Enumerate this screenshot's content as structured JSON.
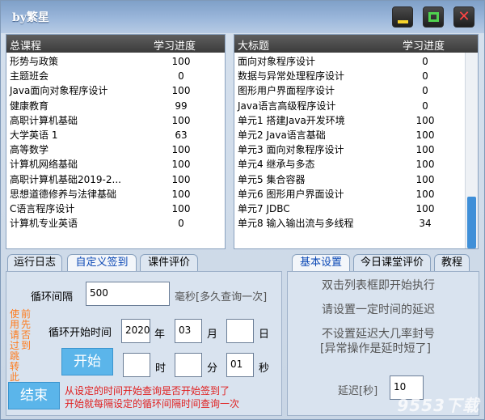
{
  "window": {
    "title": "by繁星"
  },
  "left_list": {
    "headers": [
      "总课程",
      "学习进度"
    ],
    "rows": [
      [
        "形势与政策",
        "100"
      ],
      [
        "主题班会",
        "0"
      ],
      [
        "Java面向对象程序设计",
        "100"
      ],
      [
        "健康教育",
        "99"
      ],
      [
        "高职计算机基础",
        "100"
      ],
      [
        "大学英语 1",
        "63"
      ],
      [
        "高等数学",
        "100"
      ],
      [
        "计算机网络基础",
        "100"
      ],
      [
        "高职计算机基础2019-2...",
        "100"
      ],
      [
        "思想道德修养与法律基础",
        "100"
      ],
      [
        "C语言程序设计",
        "100"
      ],
      [
        "计算机专业英语",
        "0"
      ]
    ]
  },
  "right_list": {
    "headers": [
      "大标题",
      "学习进度"
    ],
    "rows": [
      [
        "面向对象程序设计",
        "0"
      ],
      [
        "数据与异常处理程序设计",
        "0"
      ],
      [
        "图形用户界面程序设计",
        "0"
      ],
      [
        "Java语言高级程序设计",
        "0"
      ],
      [
        "单元1  搭建Java开发环境",
        "100"
      ],
      [
        "单元2  Java语言基础",
        "100"
      ],
      [
        "单元3  面向对象程序设计",
        "100"
      ],
      [
        "单元4  继承与多态",
        "100"
      ],
      [
        "单元5  集合容器",
        "100"
      ],
      [
        "单元6  图形用户界面设计",
        "100"
      ],
      [
        "单元7  JDBC",
        "100"
      ],
      [
        "单元8  输入输出流与多线程",
        "34"
      ]
    ]
  },
  "tabs_left": [
    "运行日志",
    "自定义签到",
    "课件评价"
  ],
  "tabs_right": [
    "基本设置",
    "今日课堂评价",
    "教程"
  ],
  "form": {
    "interval_label": "循环间隔",
    "interval_value": "500",
    "interval_unit": "毫秒[多久查询一次]",
    "start_time_label": "循环开始时间",
    "year_value": "2020",
    "year_unit": "年",
    "month_value": "03",
    "month_unit": "月",
    "day_value": "",
    "day_unit": "日",
    "hour_value": "",
    "hour_unit": "时",
    "minute_value": "",
    "minute_unit": "分",
    "second_value": "01",
    "second_unit": "秒",
    "start_button": "开始",
    "end_button": "结束",
    "side_note_col1": "使用请过跳转此",
    "side_note_col2": "前先否到",
    "note_line1": "从设定的时间开始查询是否开始签到了",
    "note_line2": "开始就每隔设定的循环间隔时间查询一次"
  },
  "settings": {
    "line1": "双击列表框即开始执行",
    "line2": "请设置一定时间的延迟",
    "line3": "不设置延迟大几率封号",
    "line4": "[异常操作是延时短了]",
    "delay_label": "延迟[秒]",
    "delay_value": "10"
  },
  "watermark": "9553下载"
}
